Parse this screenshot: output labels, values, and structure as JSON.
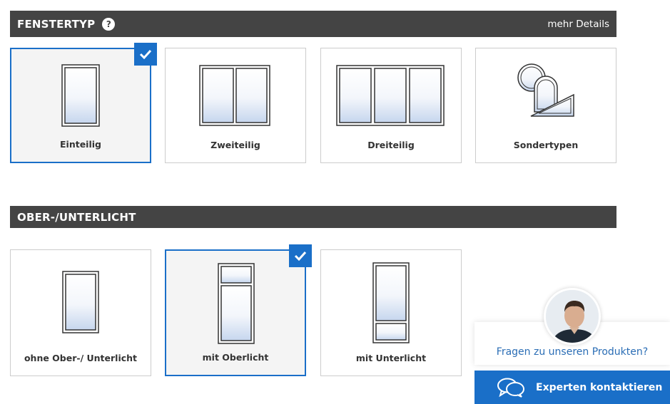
{
  "sections": {
    "window_type": {
      "title": "FENSTERTYP",
      "help_icon": "?",
      "details_link": "mehr Details",
      "options": [
        {
          "label": "Einteilig",
          "selected": true
        },
        {
          "label": "Zweiteilig",
          "selected": false
        },
        {
          "label": "Dreiteilig",
          "selected": false
        },
        {
          "label": "Sondertypen",
          "selected": false
        }
      ]
    },
    "transom": {
      "title": "OBER-/UNTERLICHT",
      "options": [
        {
          "label": "ohne Ober-/ Unterlicht",
          "selected": false
        },
        {
          "label": "mit Oberlicht",
          "selected": true
        },
        {
          "label": "mit Unterlicht",
          "selected": false
        }
      ]
    }
  },
  "chat": {
    "question": "Fragen zu unseren Produkten?",
    "button_label": "Experten kontaktieren",
    "button_icon": "chat-bubbles-icon"
  },
  "colors": {
    "accent": "#1a6fc8",
    "header_bg": "#444444",
    "link_blue": "#2a6db5"
  }
}
